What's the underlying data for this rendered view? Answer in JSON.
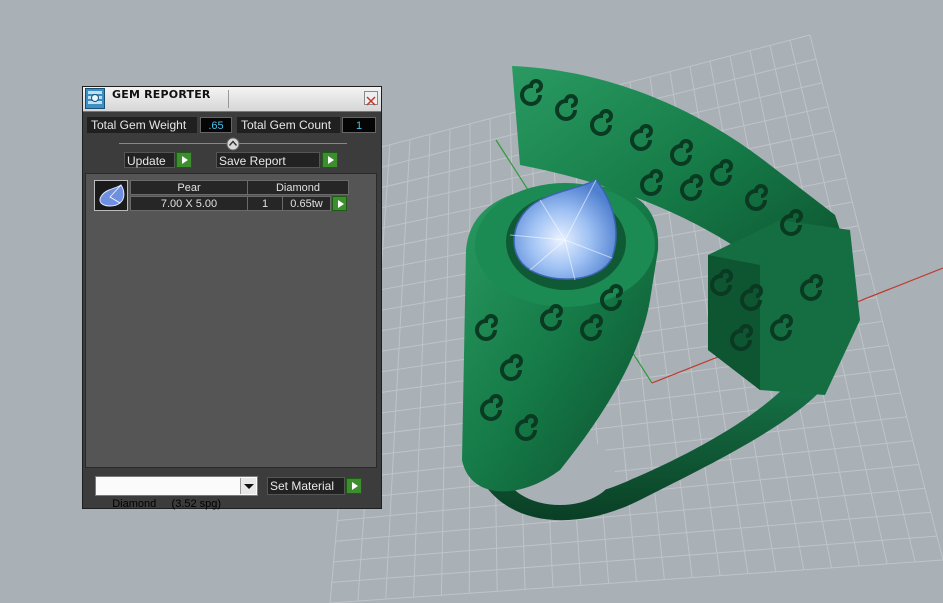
{
  "panel": {
    "title": "GEM REPORTER",
    "total_gem_weight_label": "Total Gem Weight",
    "total_gem_weight_value": ".65",
    "total_gem_count_label": "Total Gem Count",
    "total_gem_count_value": "1",
    "update_label": "Update",
    "save_report_label": "Save Report",
    "gems": [
      {
        "shape": "Pear",
        "size": "7.00 X 5.00",
        "material": "Diamond",
        "count": "1",
        "weight": "0.65tw"
      }
    ],
    "material_select_value": "Diamond     (3.52 spg)",
    "set_material_label": "Set Material"
  },
  "colors": {
    "metal": "#1f7a4d",
    "gem": "#8fb6ee",
    "viewport_bg": "#a9b0b6",
    "x_axis": "#c0392b",
    "y_axis": "#2e9a3a"
  },
  "icons": [
    "gem-reporter-app-icon",
    "close-icon",
    "slider-handle-icon",
    "play-arrow-icon",
    "pear-gem-icon",
    "chevron-down-icon"
  ]
}
